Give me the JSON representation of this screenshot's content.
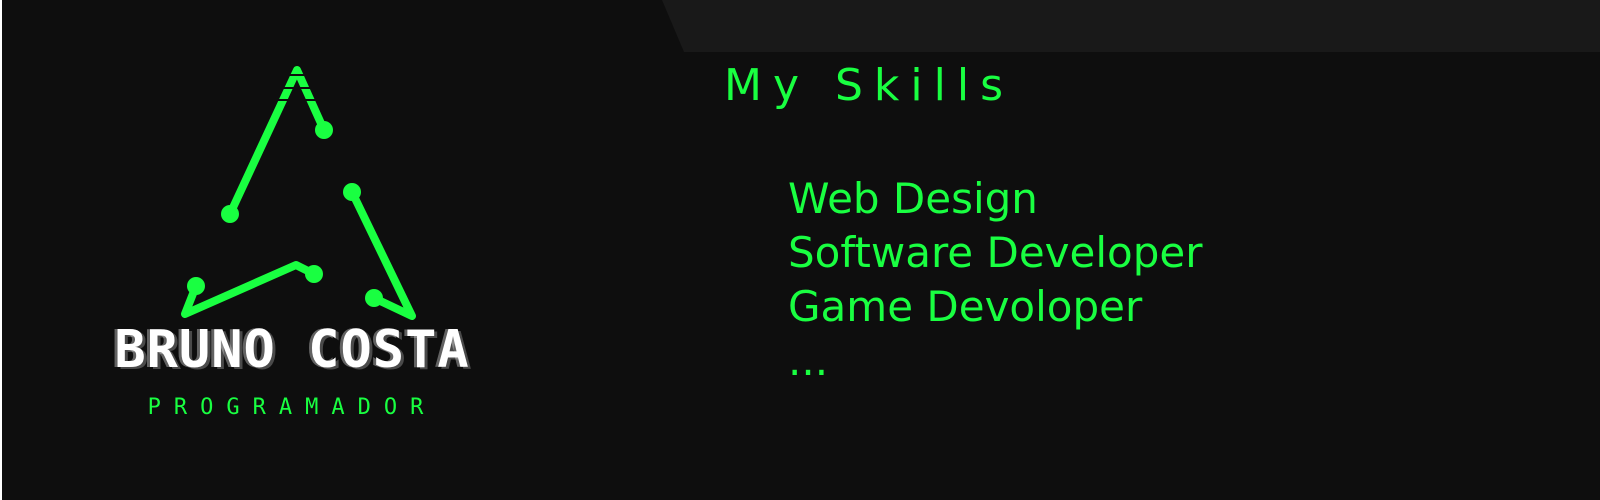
{
  "brand": {
    "name": "BRUNO COSTA",
    "subtitle": "PROGRAMADOR",
    "logo_icon": "circuit-triangle-icon"
  },
  "skills": {
    "title": "My Skills",
    "items": [
      "Web Design",
      "Software Developer",
      "Game Devoloper",
      "..."
    ]
  },
  "colors": {
    "background": "#0e0e0e",
    "top_band": "#191919",
    "accent": "#19ff41",
    "brand_text": "#ffffff"
  }
}
